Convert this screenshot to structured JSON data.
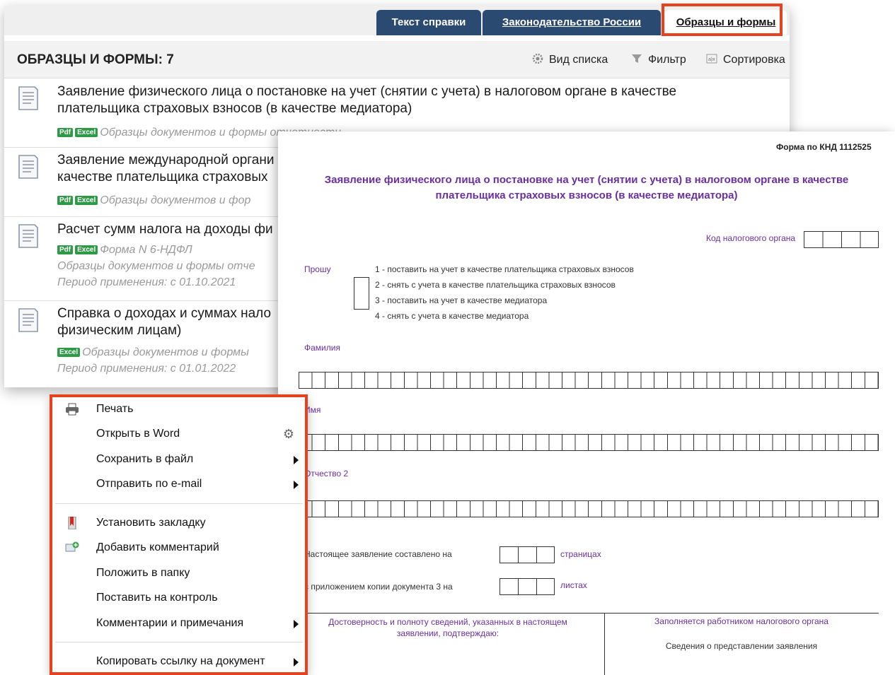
{
  "tabs": [
    {
      "label": "Текст справки"
    },
    {
      "label": "Законодательство России"
    },
    {
      "label": "Образцы и формы"
    }
  ],
  "list": {
    "title": "ОБРАЗЦЫ И ФОРМЫ: 7",
    "tools": {
      "view": "Вид списка",
      "filter": "Фильтр",
      "sort": "Сортировка"
    },
    "items": [
      {
        "title": "Заявление физического лица о постановке на учет (снятии с учета) в налоговом органе в качестве плательщика страховых взносов (в качестве медиатора)",
        "badges": [
          "Pdf",
          "Excel"
        ],
        "meta": "Образцы документов и формы отчетности"
      },
      {
        "title": "Заявление международной органи качестве плательщика страховых",
        "badges": [
          "Pdf",
          "Excel"
        ],
        "meta": "Образцы документов и фор"
      },
      {
        "title": "Расчет сумм налога на доходы фи",
        "badges": [
          "Pdf",
          "Excel"
        ],
        "meta": "Форма N 6-НДФЛ",
        "meta2": "Образцы документов и формы отче",
        "period": "Период применения: с 01.10.2021"
      },
      {
        "title": "Справка о доходах и суммах нало физическим лицам)",
        "badges": [
          "Excel"
        ],
        "meta": "Образцы документов и формы",
        "period": "Период применения: с 01.01.2022"
      }
    ]
  },
  "form": {
    "knd": "Форма по КНД 1112525",
    "title_line1": "Заявление физического лица о постановке на учет (снятии с учета) в налоговом органе в качестве",
    "title_line2": "плательщика страховых взносов (в качестве медиатора)",
    "code_label": "Код налогового органа",
    "ask_label": "Прошу",
    "options": [
      "1 - поставить на учет в качестве плательщика страховых взносов",
      "2 - снять с учета в качестве плательщика страховых взносов",
      "3 - поставить на учет в качестве медиатора",
      "4 - снять с учета в качестве медиатора"
    ],
    "surname": "Фамилия",
    "name": "Имя",
    "patronymic": "Отчество 2",
    "pages_label": "Настоящее заявление составлено на",
    "pages_unit": "страницах",
    "copies_label": "с приложением копии документа 3  на",
    "copies_unit": "листах",
    "confirm": "Достоверность и полноту сведений, указанных в настоящем заявлении, подтверждаю:",
    "office": "Заполняется работником налогового органа",
    "office_sub": "Сведения о представлении заявления"
  },
  "menu": {
    "print": "Печать",
    "open_word": "Открыть в Word",
    "save_file": "Сохранить в файл",
    "send_email": "Отправить по e-mail",
    "bookmark": "Установить закладку",
    "add_comment": "Добавить комментарий",
    "to_folder": "Положить в папку",
    "to_control": "Поставить на контроль",
    "comments_notes": "Комментарии и примечания",
    "copy_link": "Копировать ссылку на документ"
  },
  "colors": {
    "tab_bg": "#2b4a72",
    "highlight": "#e8411d",
    "form_purple": "#6a2fa0",
    "badge_green": "#2d9b46"
  }
}
